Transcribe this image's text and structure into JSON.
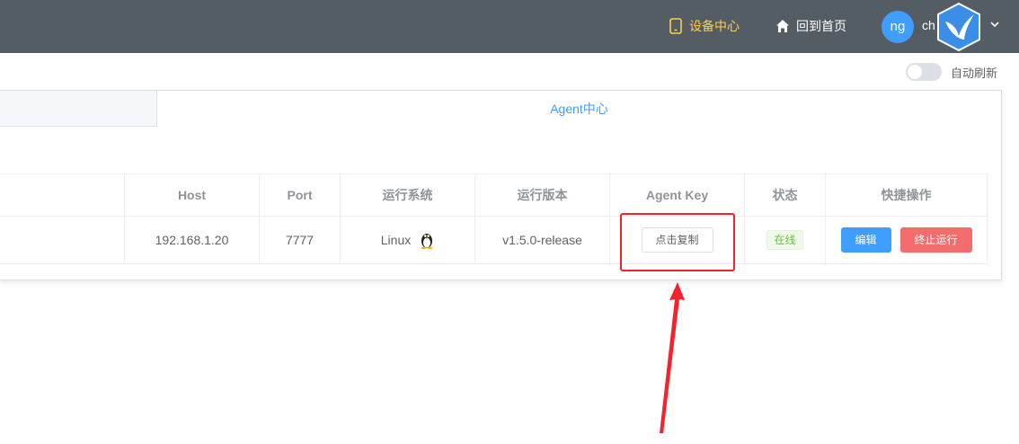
{
  "header": {
    "nav": [
      {
        "label": "设备中心",
        "icon": "tablet-icon",
        "active": true
      },
      {
        "label": "回到首页",
        "icon": "home-icon",
        "active": false
      }
    ],
    "avatar_text": "ng",
    "username": "ch"
  },
  "toolbar": {
    "auto_refresh_label": "自动刷新",
    "auto_refresh_on": false
  },
  "tabs": {
    "active_label": "Agent中心"
  },
  "table": {
    "columns": [
      "Host",
      "Port",
      "运行系统",
      "运行版本",
      "Agent Key",
      "状态",
      "快捷操作"
    ],
    "rows": [
      {
        "host": "192.168.1.20",
        "port": "7777",
        "os": "Linux",
        "os_icon": "linux-penguin-icon",
        "version": "v1.5.0-release",
        "key_button": "点击复制",
        "status": "在线",
        "edit_button": "编辑",
        "stop_button": "终止运行"
      }
    ]
  },
  "colors": {
    "header_bg": "#545c64",
    "active_nav": "#ffd04b",
    "primary": "#409eff",
    "danger": "#f56c6c",
    "success": "#67c23a",
    "highlight": "#f5222d"
  }
}
